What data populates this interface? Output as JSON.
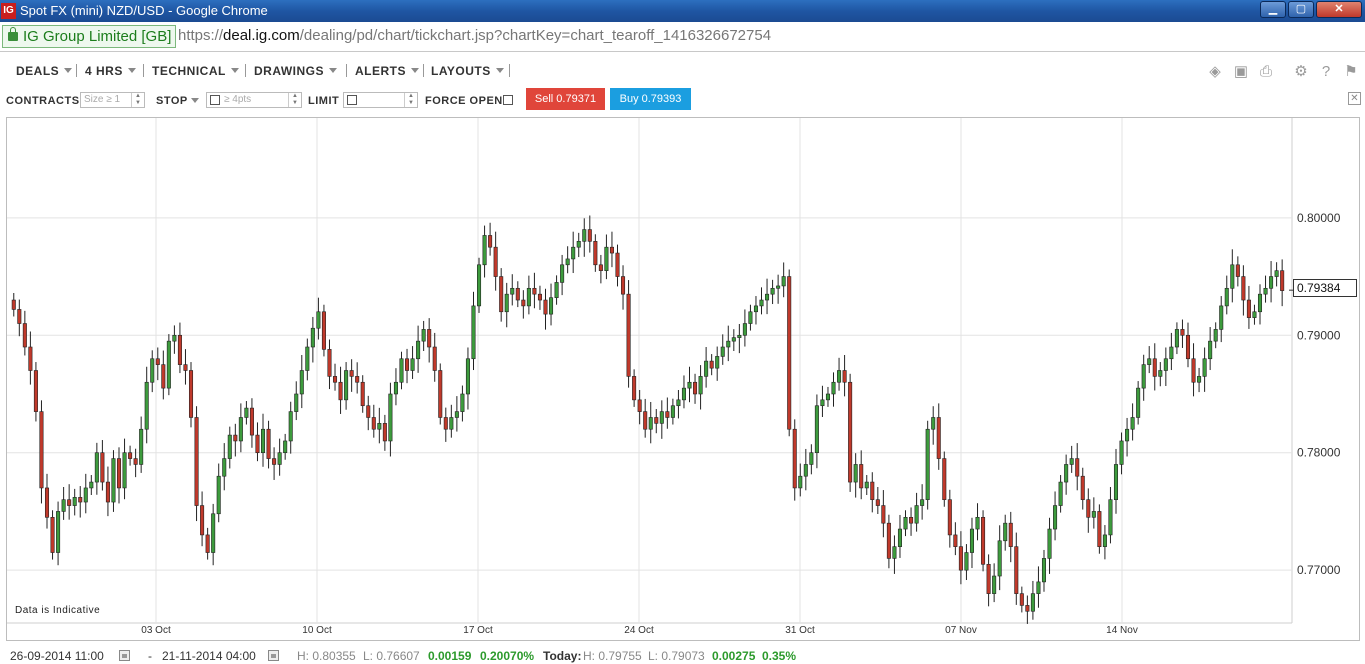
{
  "window": {
    "title": "Spot FX (mini) NZD/USD - Google Chrome",
    "app_icon": "IG",
    "minimize": "▁",
    "maximize": "▢",
    "close": "✕"
  },
  "address": {
    "secure_label": "IG Group Limited [GB]",
    "url_scheme": "https://",
    "url_host": "deal.ig.com",
    "url_path": "/dealing/pd/chart/tickchart.jsp?chartKey=chart_tearoff_1416326672754"
  },
  "toolbar": {
    "menus": [
      "DEALS",
      "4 HRS",
      "TECHNICAL",
      "DRAWINGS",
      "ALERTS",
      "LAYOUTS"
    ],
    "right_icons": [
      "layers-icon",
      "image-icon",
      "print-icon",
      "gear-icon",
      "help-icon",
      "flag-icon"
    ]
  },
  "order": {
    "contracts_label": "CONTRACTS",
    "contracts_placeholder": "Size ≥ 1",
    "stop_label": "STOP",
    "stop_placeholder": "≥ 4pts",
    "limit_label": "LIMIT",
    "force_open_label": "FORCE OPEN",
    "sell_label": "Sell 0.79371",
    "buy_label": "Buy 0.79393"
  },
  "chart_data": {
    "type": "candlestick",
    "ylim": [
      0.7655,
      0.8085
    ],
    "yticks": [
      "0.80000",
      "0.79000",
      "0.78000",
      "0.77000"
    ],
    "xticks": [
      "03 Oct",
      "10 Oct",
      "17 Oct",
      "24 Oct",
      "31 Oct",
      "07 Nov",
      "14 Nov"
    ],
    "current_price": "0.79384",
    "note": "Data is Indicative",
    "colors": {
      "up": "#3d9b3d",
      "down": "#c0392b"
    },
    "closes": [
      0.7922,
      0.791,
      0.789,
      0.787,
      0.7835,
      0.777,
      0.7745,
      0.7715,
      0.775,
      0.776,
      0.7755,
      0.7762,
      0.7758,
      0.777,
      0.7775,
      0.78,
      0.7775,
      0.7758,
      0.7795,
      0.777,
      0.78,
      0.7795,
      0.779,
      0.782,
      0.786,
      0.788,
      0.7875,
      0.7855,
      0.7895,
      0.79,
      0.7875,
      0.787,
      0.783,
      0.7755,
      0.773,
      0.7715,
      0.7748,
      0.778,
      0.7795,
      0.7815,
      0.781,
      0.783,
      0.7838,
      0.7815,
      0.78,
      0.782,
      0.7795,
      0.779,
      0.78,
      0.781,
      0.7835,
      0.785,
      0.787,
      0.789,
      0.7906,
      0.792,
      0.7888,
      0.7865,
      0.786,
      0.7845,
      0.787,
      0.7865,
      0.786,
      0.784,
      0.783,
      0.782,
      0.7825,
      0.781,
      0.785,
      0.786,
      0.788,
      0.787,
      0.788,
      0.7895,
      0.7905,
      0.789,
      0.787,
      0.783,
      0.782,
      0.783,
      0.7835,
      0.785,
      0.788,
      0.7925,
      0.796,
      0.7985,
      0.7975,
      0.795,
      0.792,
      0.7935,
      0.794,
      0.793,
      0.7925,
      0.794,
      0.7935,
      0.793,
      0.7918,
      0.7932,
      0.7945,
      0.796,
      0.7965,
      0.7975,
      0.798,
      0.799,
      0.798,
      0.796,
      0.7955,
      0.7975,
      0.797,
      0.795,
      0.7935,
      0.7865,
      0.7845,
      0.7835,
      0.782,
      0.783,
      0.7825,
      0.7835,
      0.783,
      0.784,
      0.7845,
      0.7855,
      0.786,
      0.785,
      0.7865,
      0.7878,
      0.7872,
      0.7882,
      0.789,
      0.7895,
      0.7898,
      0.79,
      0.791,
      0.792,
      0.7925,
      0.793,
      0.7935,
      0.794,
      0.7942,
      0.795,
      0.782,
      0.777,
      0.778,
      0.779,
      0.78,
      0.784,
      0.7845,
      0.785,
      0.786,
      0.787,
      0.786,
      0.7775,
      0.779,
      0.777,
      0.7775,
      0.776,
      0.7755,
      0.774,
      0.771,
      0.772,
      0.7735,
      0.7745,
      0.774,
      0.7755,
      0.776,
      0.782,
      0.783,
      0.7795,
      0.776,
      0.773,
      0.772,
      0.77,
      0.7715,
      0.7735,
      0.7745,
      0.7705,
      0.768,
      0.7695,
      0.7725,
      0.774,
      0.772,
      0.768,
      0.767,
      0.7665,
      0.768,
      0.769,
      0.771,
      0.7735,
      0.7755,
      0.7775,
      0.779,
      0.7795,
      0.778,
      0.776,
      0.7745,
      0.775,
      0.772,
      0.773,
      0.776,
      0.779,
      0.781,
      0.782,
      0.783,
      0.7855,
      0.7875,
      0.788,
      0.7865,
      0.787,
      0.788,
      0.789,
      0.7905,
      0.79,
      0.788,
      0.786,
      0.7865,
      0.788,
      0.7895,
      0.7905,
      0.7925,
      0.794,
      0.796,
      0.795,
      0.793,
      0.7915,
      0.792,
      0.7935,
      0.794,
      0.795,
      0.7955,
      0.7938
    ]
  },
  "status": {
    "from_date": "26-09-2014 11:00",
    "dash": "-",
    "to_date": "21-11-2014 04:00",
    "high": "H: 0.80355",
    "low": "L: 0.76607",
    "change": "0.00159",
    "change_pct": "0.20070%",
    "today_label": "Today:",
    "today_high": "H: 0.79755",
    "today_low": "L: 0.79073",
    "today_change": "0.00275",
    "today_pct": "0.35%"
  }
}
